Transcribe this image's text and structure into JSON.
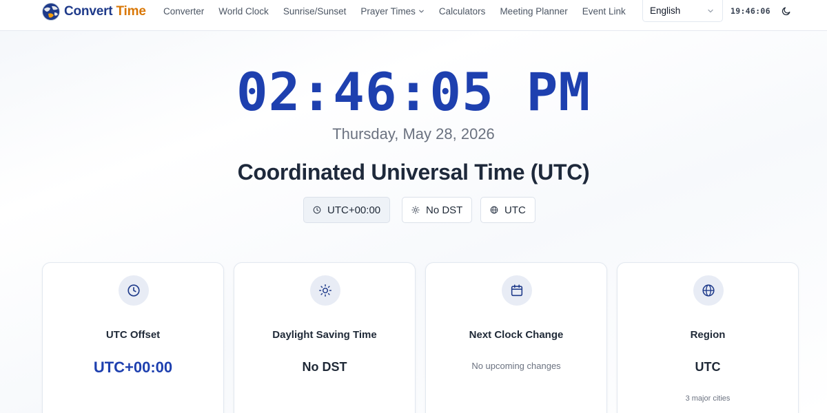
{
  "brand": {
    "name_part1": "Convert",
    "name_part2": "Time"
  },
  "nav": [
    {
      "label": "Converter"
    },
    {
      "label": "World Clock"
    },
    {
      "label": "Sunrise/Sunset"
    },
    {
      "label": "Prayer Times",
      "has_dropdown": true
    },
    {
      "label": "Calculators"
    },
    {
      "label": "Meeting Planner"
    },
    {
      "label": "Event Link"
    }
  ],
  "language": {
    "selected": "English"
  },
  "header_clock": "19:46:06",
  "hero": {
    "time": "02:46:05 PM",
    "date": "Thursday, May 28, 2026",
    "zone_name": "Coordinated Universal Time (UTC)",
    "badges": [
      {
        "label": "UTC+00:00",
        "icon": "clock-icon"
      },
      {
        "label": "No DST",
        "icon": "sun-icon"
      },
      {
        "label": "UTC",
        "icon": "globe-icon"
      }
    ]
  },
  "cards": [
    {
      "icon": "clock-icon",
      "label": "UTC Offset",
      "value": "UTC+00:00"
    },
    {
      "icon": "sun-icon",
      "label": "Daylight Saving Time",
      "value": "No DST"
    },
    {
      "icon": "calendar-icon",
      "label": "Next Clock Change",
      "value": "No upcoming changes"
    },
    {
      "icon": "globe-icon",
      "label": "Region",
      "value": "UTC",
      "sub": "3 major cities"
    }
  ],
  "colors": {
    "primary": "#1e40af",
    "brand_blue": "#1e3a8a",
    "brand_orange": "#d97706",
    "icon_bg": "#e8ecf5"
  }
}
